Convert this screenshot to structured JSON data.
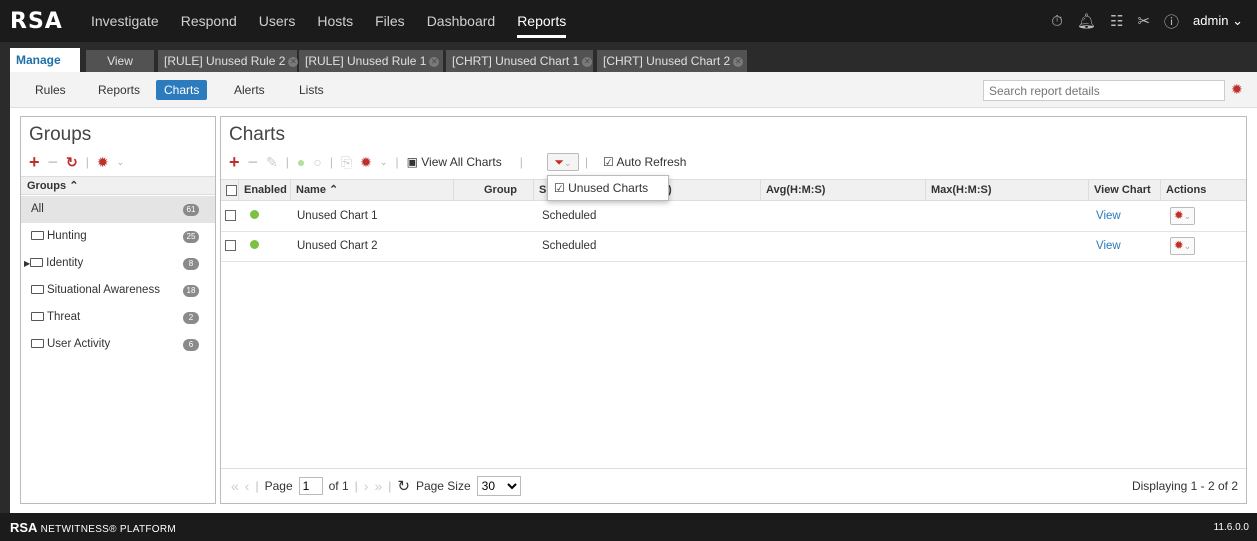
{
  "app": {
    "logo": "RSA"
  },
  "topnav": {
    "items": [
      "Investigate",
      "Respond",
      "Users",
      "Hosts",
      "Files",
      "Dashboard",
      "Reports"
    ],
    "active": "Reports",
    "user": "admin"
  },
  "tabs": [
    {
      "label": "Manage"
    },
    {
      "label": "View"
    },
    {
      "label": "[RULE] Unused Rule 2"
    },
    {
      "label": "[RULE] Unused Rule 1"
    },
    {
      "label": "[CHRT] Unused Chart 1"
    },
    {
      "label": "[CHRT] Unused Chart 2"
    }
  ],
  "subnav": {
    "items": [
      "Rules",
      "Reports",
      "Charts",
      "Alerts",
      "Lists"
    ],
    "active": "Charts",
    "search_placeholder": "Search report details"
  },
  "groups_panel": {
    "title": "Groups",
    "column_header": "Groups",
    "items": [
      {
        "name": "All",
        "count": "61"
      },
      {
        "name": "Hunting",
        "count": "25"
      },
      {
        "name": "Identity",
        "count": "8"
      },
      {
        "name": "Situational Awareness",
        "count": "18"
      },
      {
        "name": "Threat",
        "count": "2"
      },
      {
        "name": "User Activity",
        "count": "6"
      }
    ]
  },
  "charts_panel": {
    "title": "Charts",
    "view_all_label": "View All Charts",
    "auto_refresh_label": "Auto Refresh",
    "filter_menu_item": "Unused Charts",
    "columns": {
      "enabled": "Enabled",
      "name": "Name",
      "group": "Group",
      "status_visible": "S",
      "hidden_tail": ")",
      "avg": "Avg(H:M:S)",
      "max": "Max(H:M:S)",
      "view_chart": "View Chart",
      "actions": "Actions"
    },
    "rows": [
      {
        "name": "Unused Chart 1",
        "group": "",
        "status": "Scheduled",
        "view": "View"
      },
      {
        "name": "Unused Chart 2",
        "group": "",
        "status": "Scheduled",
        "view": "View"
      }
    ],
    "pager": {
      "page_label": "Page",
      "page_value": "1",
      "of_label": "of 1",
      "page_size_label": "Page Size",
      "page_size": "30",
      "displaying": "Displaying 1 - 2 of 2"
    }
  },
  "footer": {
    "brand": "RSA",
    "product": "NETWITNESS® PLATFORM",
    "version": "11.6.0.0"
  },
  "colors": {
    "accent": "#2b7bbd",
    "danger": "#c0302b",
    "enabled_dot": "#7cc142",
    "topbar": "#1b1b1b"
  }
}
